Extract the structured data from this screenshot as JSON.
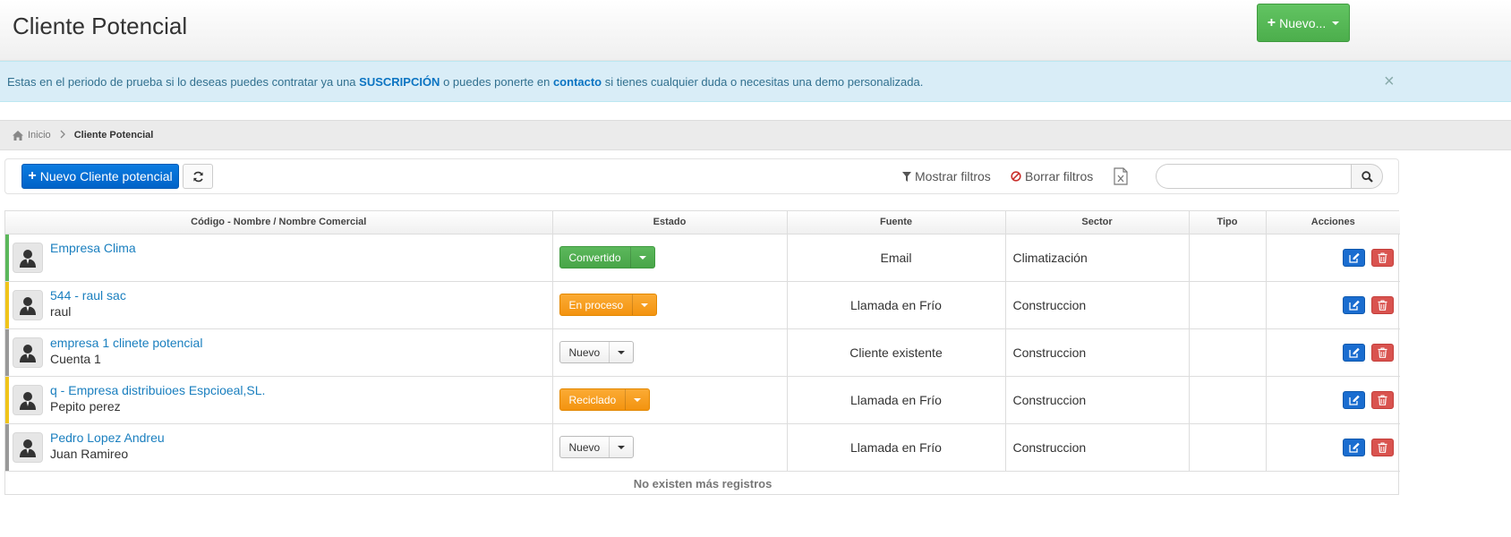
{
  "header": {
    "title": "Cliente Potencial",
    "new_button": "Nuevo..."
  },
  "alert": {
    "text_before": "Estas en el periodo de prueba si lo deseas puedes contratar ya una ",
    "link_subscription": "SUSCRIPCIÓN",
    "text_middle": " o puedes ponerte en ",
    "link_contact": "contacto",
    "text_after": " si tienes cualquier duda o necesitas una demo personalizada.",
    "close": "×"
  },
  "breadcrumb": {
    "home": "Inicio",
    "current": "Cliente Potencial"
  },
  "toolbar": {
    "new_lead_button": "Nuevo Cliente potencial",
    "show_filters": "Mostrar filtros",
    "clear_filters": "Borrar filtros",
    "search_value": "",
    "search_placeholder": ""
  },
  "table": {
    "columns": [
      "Código - Nombre / Nombre Comercial",
      "Estado",
      "Fuente",
      "Sector",
      "Tipo",
      "Acciones"
    ],
    "rows": [
      {
        "name": "Empresa Clima",
        "sub": "",
        "estado": "Convertido",
        "estado_style": "green",
        "stripe_color": "#5cb85c",
        "fuente": "Email",
        "sector": "Climatización",
        "tipo": ""
      },
      {
        "name": "544 - raul sac",
        "sub": "raul",
        "estado": "En proceso",
        "estado_style": "orange",
        "stripe_color": "#f0c419",
        "fuente": "Llamada en Frío",
        "sector": "Construccion",
        "tipo": ""
      },
      {
        "name": "empresa 1 clinete potencial",
        "sub": "Cuenta 1",
        "estado": "Nuevo",
        "estado_style": "default",
        "stripe_color": "#999999",
        "fuente": "Cliente existente",
        "sector": "Construccion",
        "tipo": ""
      },
      {
        "name": "q - Empresa distribuioes Espcioeal,SL.",
        "sub": "Pepito perez",
        "estado": "Reciclado",
        "estado_style": "orange",
        "stripe_color": "#f0c419",
        "fuente": "Llamada en Frío",
        "sector": "Construccion",
        "tipo": ""
      },
      {
        "name": "Pedro Lopez Andreu",
        "sub": "Juan Ramireo",
        "estado": "Nuevo",
        "estado_style": "default",
        "stripe_color": "#999999",
        "fuente": "Llamada en Frío",
        "sector": "Construccion",
        "tipo": ""
      }
    ],
    "footer": "No existen más registros"
  },
  "icons": {
    "home": "home-icon",
    "chevron": "chevron-right-icon",
    "plus": "plus-icon",
    "refresh": "refresh-icon",
    "filter": "filter-icon",
    "ban": "ban-icon",
    "excel": "excel-export-icon",
    "search": "search-icon",
    "avatar": "user-avatar-icon",
    "edit": "edit-icon",
    "delete": "trash-icon"
  }
}
